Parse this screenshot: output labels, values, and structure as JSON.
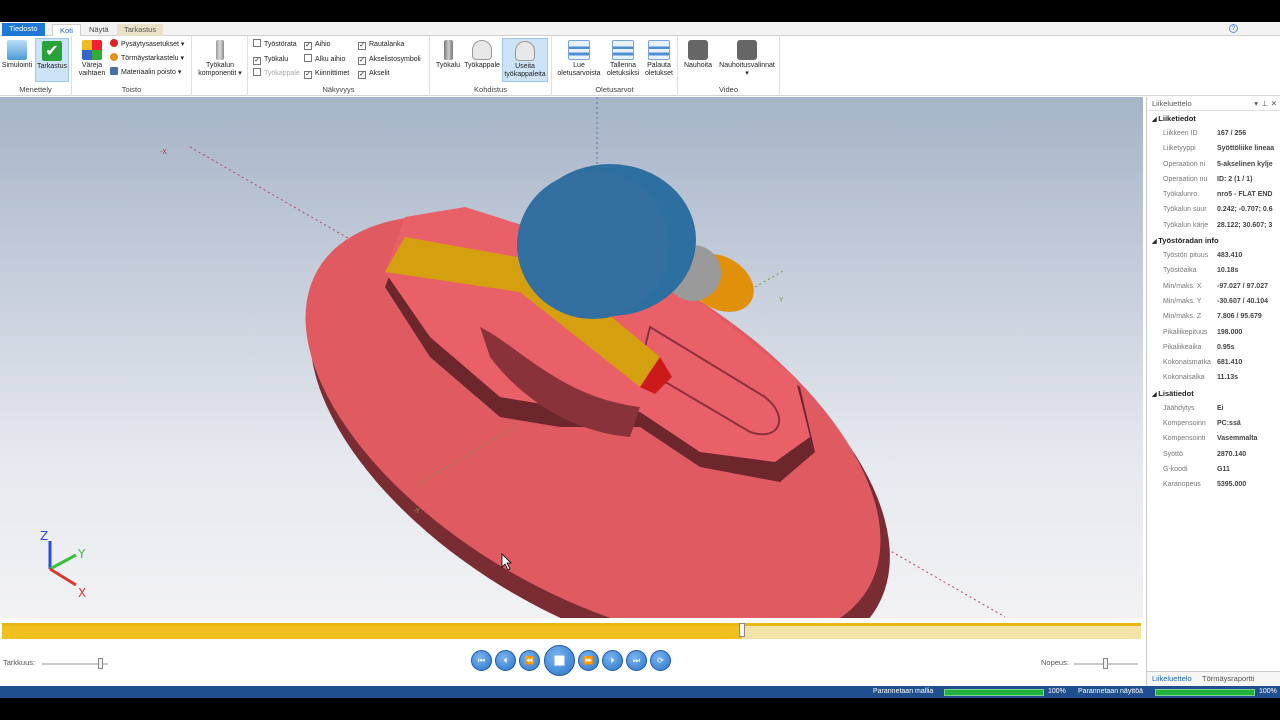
{
  "tabs": [
    "Tiedosto",
    "Koti",
    "Näytä",
    "Tarkastus"
  ],
  "ribbon": {
    "menettely": {
      "label": "Menettely",
      "buttons": [
        "Simulointi",
        "Tarkastus"
      ]
    },
    "toisto": {
      "label": "Toisto",
      "big": "Väreja vaihtaen",
      "items": [
        "Pysäytysasetukset",
        "Törmäystarkastelu",
        "Materiaalin poisto"
      ]
    },
    "komponentit": {
      "label": "Työkalun komponentit"
    },
    "nakyvyys": {
      "label": "Näkyvyys",
      "col1": [
        {
          "text": "Työstörata",
          "checked": false
        },
        {
          "text": "Työkalu",
          "checked": true
        },
        {
          "text": "Työkappale",
          "checked": false,
          "dim": true
        }
      ],
      "col2": [
        {
          "text": "Aihio",
          "checked": true
        },
        {
          "text": "Alku aihio",
          "checked": false
        },
        {
          "text": "Kiinnittimet",
          "checked": true
        }
      ],
      "col3": [
        {
          "text": "Rautalanka",
          "checked": true
        },
        {
          "text": "Akselistosymboli",
          "checked": true
        },
        {
          "text": "Akselit",
          "checked": true
        }
      ]
    },
    "kohdistus": {
      "label": "Kohdistus",
      "buttons": [
        "Työkalu",
        "Työkappale",
        "Useita työkappaleita"
      ]
    },
    "oletusarvot": {
      "label": "Oletusarvot",
      "buttons": [
        "Lue oletusarvoista",
        "Tallenna oletuksiksi",
        "Palauta oletukset"
      ]
    },
    "video": {
      "label": "Video",
      "buttons": [
        "Nauhoita",
        "Nauhoitusvalinnat"
      ]
    }
  },
  "viewport": {
    "axis_neg_x": "-X",
    "axis_y": "Y",
    "axis_neg_y": "-Y",
    "triad": {
      "z": "Z",
      "y": "Y",
      "x": "X"
    }
  },
  "timeline": {
    "progress": 0.65
  },
  "controls": {
    "accuracy_label": "Tarkkuus:",
    "speed_label": "Nopeus:",
    "buttons": [
      "first",
      "prev",
      "rewind",
      "stop",
      "play",
      "next",
      "last",
      "loop"
    ]
  },
  "panel": {
    "title": "Liikeluettelo",
    "sections": [
      {
        "title": "Liiketiedot",
        "rows": [
          [
            "Liikkeen ID",
            "167 / 256"
          ],
          [
            "Liiketyyppi",
            "Syöttöliike lineaa"
          ],
          [
            "Operaation ni",
            "5-akselinen kylje"
          ],
          [
            "Operaation nu",
            "ID: 2 (1 / 1)"
          ],
          [
            "Työkalunro.",
            "nro5 - FLAT END"
          ],
          [
            "Työkalun suur",
            "0.242; -0.707; 0.6"
          ],
          [
            "Työkalun kärje",
            "28.122; 30.607; 3"
          ]
        ]
      },
      {
        "title": "Työstöradan info",
        "rows": [
          [
            "Työstön pituus",
            "483.410"
          ],
          [
            "Työstöaika",
            "10.18s"
          ],
          [
            "Min/maks. X",
            "-97.027 / 97.027"
          ],
          [
            "Min/maks. Y",
            "-30.607 / 40.104"
          ],
          [
            "Min/maks. Z",
            "7.806 / 95.679"
          ],
          [
            "Pikaliikepituus",
            "198.000"
          ],
          [
            "Pikaliikeaika",
            "0.95s"
          ],
          [
            "Kokonaismatka",
            "681.410"
          ],
          [
            "Kokonaisaika",
            "11.13s"
          ]
        ]
      },
      {
        "title": "Lisätiedot",
        "rows": [
          [
            "Jäähdytys",
            "Ei"
          ],
          [
            "Kompensoinn",
            "PC:ssä"
          ],
          [
            "Kompensointi",
            "Vasemmalta"
          ],
          [
            "Syöttö",
            "2870.140"
          ],
          [
            "G-koodi",
            "G11"
          ],
          [
            "Karanopeus",
            "5395.000"
          ]
        ]
      }
    ],
    "tabs": [
      "Liikeluettelo",
      "Törmäysraportti"
    ]
  },
  "status": {
    "task1": "Parannetaan mallia",
    "pct1": "100%",
    "task2": "Parannetaan näyttöä",
    "pct2": "100%"
  }
}
